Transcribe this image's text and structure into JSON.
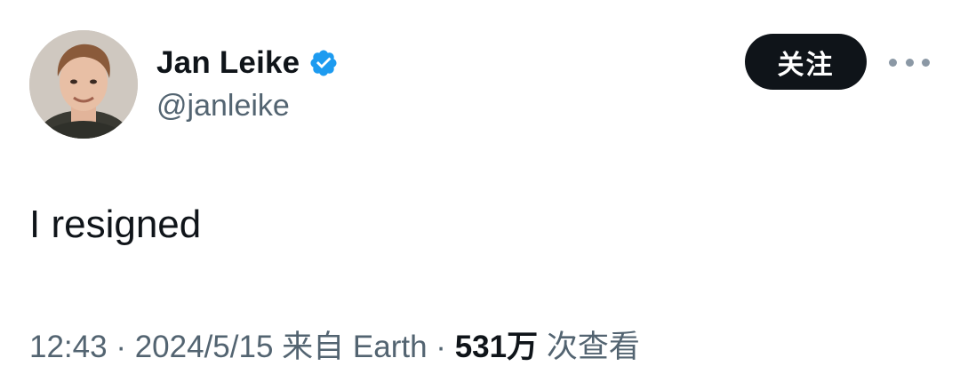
{
  "author": {
    "display_name": "Jan Leike",
    "handle": "@janleike",
    "verified": true,
    "avatar": "profile-photo"
  },
  "actions": {
    "follow_label": "关注",
    "more_icon": "more-horizontal-icon"
  },
  "tweet": {
    "text": "I resigned"
  },
  "meta": {
    "time": "12:43",
    "separator": "·",
    "date": "2024/5/15",
    "source": "来自 Earth",
    "views_count": "531万",
    "views_label": "次查看"
  },
  "colors": {
    "text_primary": "#0f1419",
    "text_secondary": "#536471",
    "verified_blue": "#1d9bf0",
    "follow_button_bg": "#0f1419",
    "follow_button_text": "#ffffff"
  }
}
